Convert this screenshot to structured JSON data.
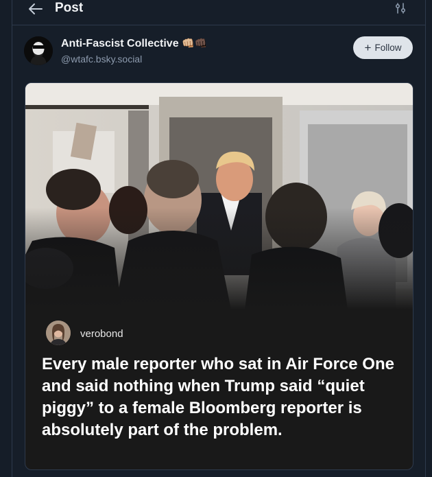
{
  "header": {
    "title": "Post"
  },
  "post": {
    "author_name": "Anti-Fascist Collective",
    "author_emoji": "👊🏼👊🏿",
    "author_handle": "@wtafc.bsky.social",
    "follow_label": "Follow"
  },
  "embed": {
    "quote_author": "verobond",
    "quote_text": "Every male reporter who sat in Air Force One and said nothing when Trump said “quiet piggy” to a female Bloomberg reporter is absolutely part of the problem."
  },
  "icons": {
    "back": "arrow-left-icon",
    "filter": "sliders-icon",
    "follow": "plus-icon"
  },
  "colors": {
    "background": "#151d28",
    "border": "#2e3a4c",
    "handle": "#8d9bae",
    "follow_button": "#dfe4ea"
  }
}
